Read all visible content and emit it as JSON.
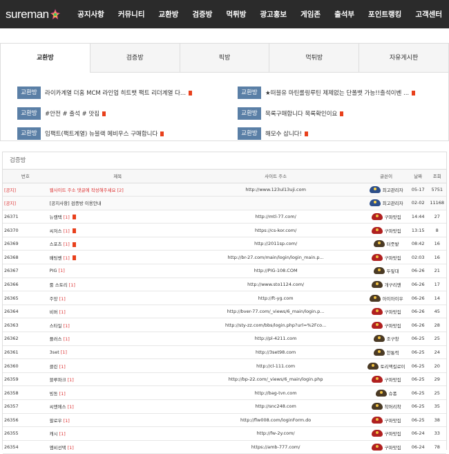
{
  "logo": {
    "text": "sureman"
  },
  "nav": [
    "공지사항",
    "커뮤니티",
    "교환방",
    "검증방",
    "먹튀방",
    "광고홍보",
    "게임존",
    "출석부",
    "포인트랭킹",
    "고객센터"
  ],
  "tabs": [
    "교환방",
    "검증방",
    "픽방",
    "먹튀방",
    "자유게시판"
  ],
  "active_tab": "교환방",
  "posts_left": [
    {
      "badge": "교환방",
      "title": "라이카계열 더홈 MCM 라인업 히트뱃 팩트 리더계열 다..."
    },
    {
      "badge": "교환방",
      "title": "#안전 # 출석 # 맛집"
    },
    {
      "badge": "교환방",
      "title": "임팩트(팩트계열) 뉴블랙 메비우스 구매합니다"
    }
  ],
  "posts_right": [
    {
      "badge": "교환방",
      "title": "★떠블유 마틴롤링루틴 제제없는 단폴뱃 가능!!출석이벤 ..."
    },
    {
      "badge": "교환방",
      "title": "목록구매합니다 목록확인이요"
    },
    {
      "badge": "교환방",
      "title": "해모수 삽니다!"
    }
  ],
  "board": {
    "title": "검증방",
    "headers": {
      "no": "번호",
      "subject": "제목",
      "site": "사이트 주소",
      "writer": "글쓴이",
      "date": "날짜",
      "views": "조회"
    },
    "rows": [
      {
        "no": "[공지]",
        "subject": "웹사이트 주소 댓글에 작성해주세요",
        "count": "[2]",
        "site": "http://www.123ul13uji.com",
        "writer": "최고관리자",
        "date": "05-17",
        "views": "5751",
        "notice": true,
        "avatar": "admin"
      },
      {
        "no": "[공지]",
        "subject": "[공지사항] 검증방 이용안내",
        "count": "",
        "site": "",
        "writer": "최고관리자",
        "date": "02-02",
        "views": "11168",
        "notice": true,
        "avatar": "admin"
      },
      {
        "no": "26371",
        "subject": "뉴캠택",
        "count": "[1]",
        "site": "http://mtl-77.com/",
        "writer": "구파맛집",
        "date": "14:44",
        "views": "27",
        "new": true,
        "avatar": "red"
      },
      {
        "no": "26370",
        "subject": "씨저스",
        "count": "[1]",
        "site": "https://cs-kor.com/",
        "writer": "구파맛집",
        "date": "13:15",
        "views": "8",
        "new": true,
        "avatar": "red"
      },
      {
        "no": "26369",
        "subject": "스포츠",
        "count": "[1]",
        "site": "http://2011sp.com/",
        "writer": "터줏밭",
        "date": "08:42",
        "views": "16",
        "new": true,
        "avatar": "brown"
      },
      {
        "no": "26368",
        "subject": "배팅벤",
        "count": "[1]",
        "site": "http://br-27.com/main/login/login_main.p...",
        "writer": "구파맛집",
        "date": "02:03",
        "views": "16",
        "new": true,
        "avatar": "red"
      },
      {
        "no": "26367",
        "subject": "PIG",
        "count": "[1]",
        "site": "http://PIG-108.COM",
        "writer": "두잎대",
        "date": "06-26",
        "views": "21",
        "avatar": "brown"
      },
      {
        "no": "26366",
        "subject": "룰 스토리",
        "count": "[1]",
        "site": "http://www.sto1124.com/",
        "writer": "개구리맨",
        "date": "06-26",
        "views": "17",
        "avatar": "brown"
      },
      {
        "no": "26365",
        "subject": "주앙",
        "count": "[1]",
        "site": "http://ft-yg.com",
        "writer": "아이아이우",
        "date": "06-26",
        "views": "14",
        "avatar": "brown"
      },
      {
        "no": "26364",
        "subject": "비버",
        "count": "[1]",
        "site": "http://bver-77.com/_views/6_main/login.p...",
        "writer": "구파맛집",
        "date": "06-26",
        "views": "45",
        "avatar": "red"
      },
      {
        "no": "26363",
        "subject": "스타일",
        "count": "[1]",
        "site": "http://sty-zz.com/bbs/login.php?url=%2Fco...",
        "writer": "구파맛집",
        "date": "06-26",
        "views": "28",
        "avatar": "red"
      },
      {
        "no": "26362",
        "subject": "플러스",
        "count": "[1]",
        "site": "http://pl-4211.com",
        "writer": "조구창",
        "date": "06-25",
        "views": "25",
        "avatar": "brown"
      },
      {
        "no": "26361",
        "subject": "3set",
        "count": "[1]",
        "site": "http://3set98.com",
        "writer": "한통력",
        "date": "06-25",
        "views": "24",
        "avatar": "brown"
      },
      {
        "no": "26360",
        "subject": "클린",
        "count": "[1]",
        "site": "http://cl-111.com",
        "writer": "토리맥킬로이",
        "date": "06-25",
        "views": "20",
        "avatar": "brown"
      },
      {
        "no": "26359",
        "subject": "블루파크",
        "count": "[1]",
        "site": "http://bp-22.com/_views/6_main/login.php",
        "writer": "구파맛집",
        "date": "06-25",
        "views": "29",
        "avatar": "red"
      },
      {
        "no": "26358",
        "subject": "빙동",
        "count": "[1]",
        "site": "http://bag-tvn.com",
        "writer": "슈퐁",
        "date": "06-25",
        "views": "25",
        "avatar": "brown"
      },
      {
        "no": "26357",
        "subject": "씨앤에스",
        "count": "[1]",
        "site": "http://snc248.com",
        "writer": "착머리착",
        "date": "06-25",
        "views": "35",
        "avatar": "brown"
      },
      {
        "no": "26356",
        "subject": "팔로우",
        "count": "[1]",
        "site": "http://flw008.com/loginForm.do",
        "writer": "구파맛집",
        "date": "06-25",
        "views": "38",
        "avatar": "red"
      },
      {
        "no": "26355",
        "subject": "캐시",
        "count": "[1]",
        "site": "http://fw-2y.com/",
        "writer": "구파맛집",
        "date": "06-24",
        "views": "33",
        "avatar": "red"
      },
      {
        "no": "26354",
        "subject": "엠비선택",
        "count": "[1]",
        "site": "https://amb-777.com/",
        "writer": "구파맛집",
        "date": "06-24",
        "views": "78",
        "avatar": "red"
      }
    ]
  },
  "colors": {
    "nav_bg": "#2b2b2b",
    "badge_bg": "#5a7fa6",
    "new_mark": "#e8401c",
    "notice_red": "#dd3333"
  }
}
